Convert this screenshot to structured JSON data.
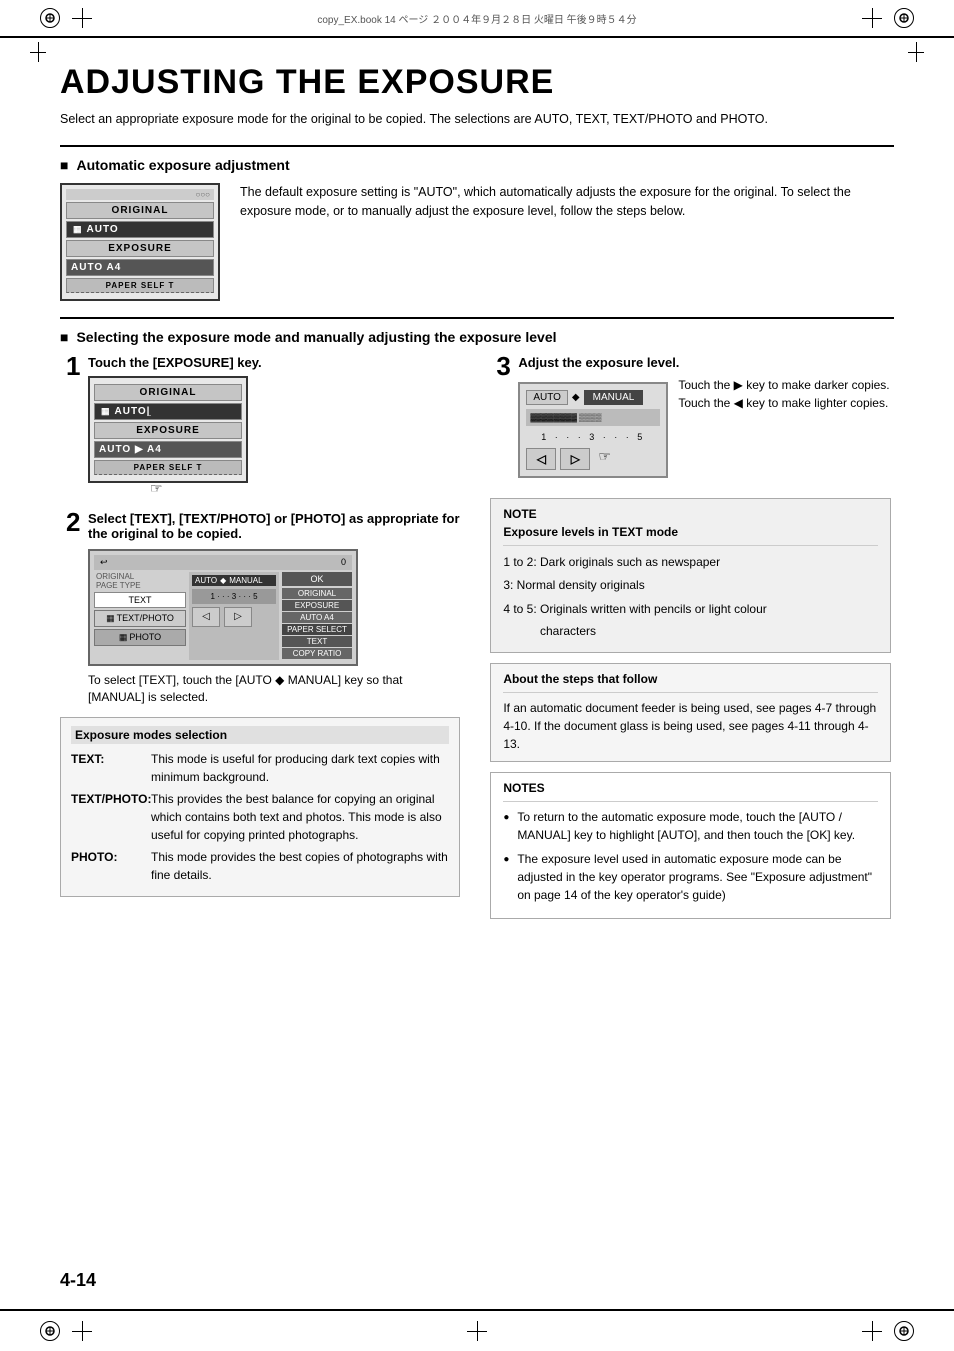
{
  "header": {
    "file_info": "copy_EX.book  14 ページ  ２００４年９月２８日  火曜日  午後９時５４分"
  },
  "page_title": "ADJUSTING THE EXPOSURE",
  "intro": "Select an appropriate exposure mode for the original to be copied. The selections are AUTO, TEXT, TEXT/PHOTO and PHOTO.",
  "section1": {
    "heading": "Automatic exposure adjustment",
    "description": "The default exposure setting is \"AUTO\", which automatically adjusts the exposure for the original. To select the exposure mode, or to manually adjust the exposure level, follow the steps below."
  },
  "section2": {
    "heading": "Selecting the exposure mode and manually adjusting the exposure level",
    "step1": {
      "number": "1",
      "label": "Touch the [EXPOSURE] key."
    },
    "step2": {
      "number": "2",
      "label": "Select [TEXT], [TEXT/PHOTO] or [PHOTO] as appropriate for the original to be copied.",
      "note": "To select [TEXT], touch the [AUTO ◆ MANUAL] key so that [MANUAL] is selected."
    },
    "step3": {
      "number": "3",
      "label": "Adjust the exposure level.",
      "description_right": "Touch the  ▶  key to make darker copies. Touch the  ◀  key to make lighter copies."
    }
  },
  "exposure_modes": {
    "title": "Exposure modes selection",
    "modes": [
      {
        "name": "TEXT:",
        "description": "This mode is useful for producing dark text copies with minimum background."
      },
      {
        "name": "TEXT/PHOTO:",
        "description": "This provides the best balance for copying an original which contains both text and photos. This mode is also useful for copying printed photographs."
      },
      {
        "name": "PHOTO:",
        "description": "This mode provides the best copies of photographs with fine details."
      }
    ]
  },
  "note_box": {
    "title": "NOTE",
    "subtitle": "Exposure levels in TEXT mode",
    "items": [
      "1 to 2:  Dark originals such as newspaper",
      "3:         Normal density originals",
      "4 to 5:  Originals written with pencils or light colour characters"
    ]
  },
  "about_box": {
    "title": "About the steps that follow",
    "text": "If an automatic document feeder is being used, see pages 4-7 through 4-10. If the document glass is being used, see pages 4-11 through 4-13."
  },
  "notes_box": {
    "title": "NOTES",
    "items": [
      "To return to the automatic exposure mode, touch the [AUTO / MANUAL] key to highlight [AUTO], and then touch the [OK] key.",
      "The exposure level used in automatic exposure mode can be adjusted in the key operator programs. See \"Exposure adjustment\" on page 14 of the key operator's guide)"
    ]
  },
  "page_number": "4-14",
  "lcd": {
    "original": "ORIGINAL",
    "auto": "AUTO",
    "exposure": "EXPOSURE",
    "auto_a4": "AUTO    A4",
    "paper_self": "PAPER  SELF  T"
  }
}
